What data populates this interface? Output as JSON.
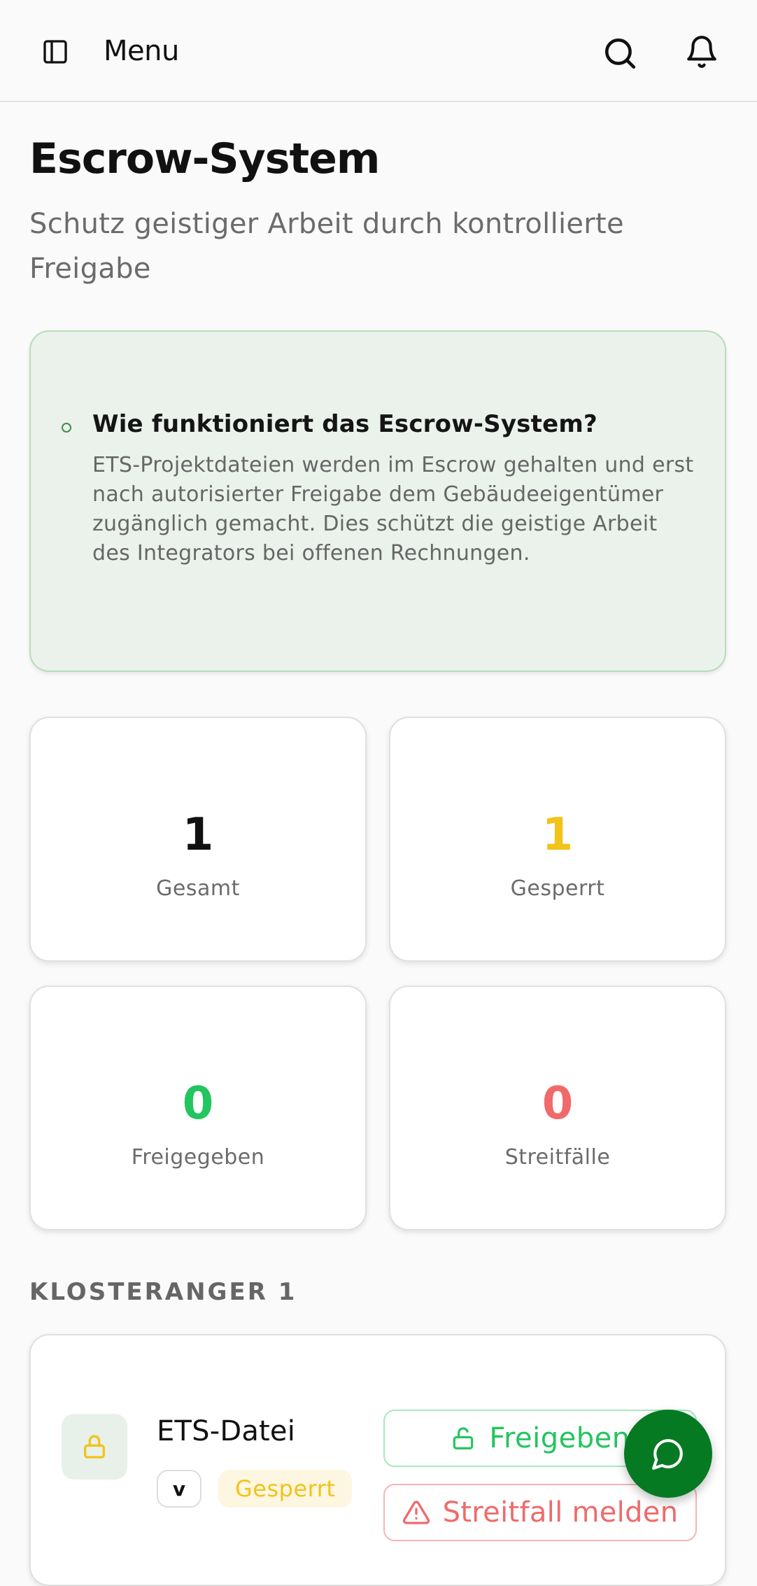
{
  "header": {
    "menu_label": "Menu",
    "menu_icon": "sidebar-panel-icon",
    "search_icon": "search-icon",
    "notifications_icon": "bell-icon"
  },
  "page": {
    "title": "Escrow-System",
    "subtitle": "Schutz geistiger Arbeit durch kontrollierte Freigabe"
  },
  "info": {
    "title": "Wie funktioniert das Escrow-System?",
    "text": "ETS-Projektdateien werden im Escrow gehalten und erst nach autorisierter Freigabe dem Gebäudeeigentümer zugänglich gemacht. Dies schützt die geistige Arbeit des Integrators bei offenen Rechnungen."
  },
  "stats": {
    "total": {
      "value": "1",
      "label": "Gesamt",
      "color": "#111111"
    },
    "locked": {
      "value": "1",
      "label": "Gesperrt",
      "color": "#f2c318"
    },
    "released": {
      "value": "0",
      "label": "Freigegeben",
      "color": "#22c55e"
    },
    "disputes": {
      "value": "0",
      "label": "Streitfälle",
      "color": "#f06a6a"
    }
  },
  "section": {
    "heading": "KLOSTERANGER 1"
  },
  "file": {
    "name": "ETS-Datei",
    "version_badge": "v",
    "status": "Gesperrt",
    "meta": "",
    "release_label": "Freigeben",
    "dispute_label": "Streitfall melden"
  },
  "colors": {
    "accent_green": "#067a22",
    "info_bg": "#ebf2ec",
    "info_border": "#b7dcb9"
  }
}
